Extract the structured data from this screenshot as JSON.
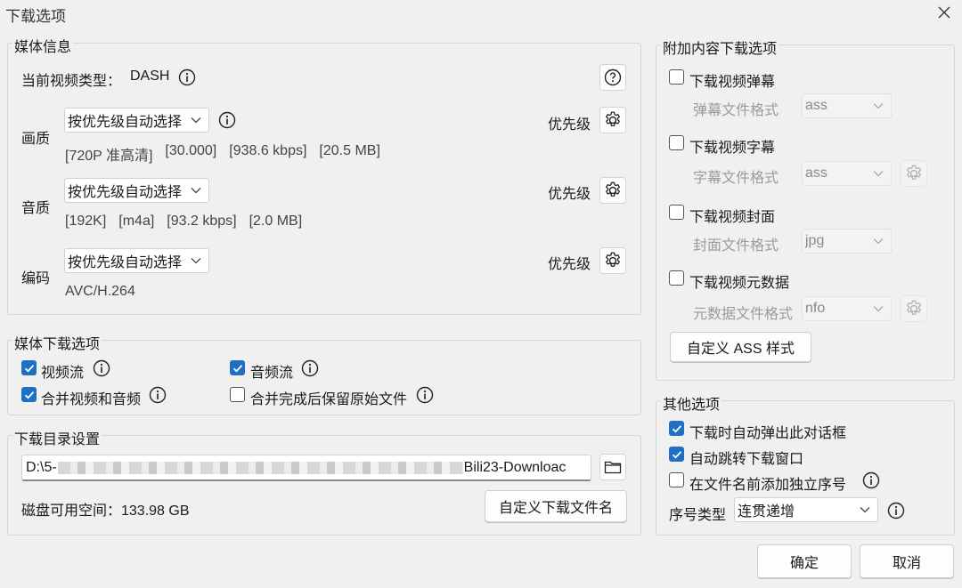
{
  "window": {
    "title": "下载选项",
    "close_icon": "close-icon"
  },
  "media_info": {
    "group_title": "媒体信息",
    "video_type_label": "当前视频类型：",
    "video_type_value": "DASH",
    "quality": {
      "label": "画质",
      "select": "按优先级自动选择",
      "priority_label": "优先级",
      "details": [
        "[720P 准高清]",
        "[30.000]",
        "[938.6 kbps]",
        "[20.5 MB]"
      ]
    },
    "audio": {
      "label": "音质",
      "select": "按优先级自动选择",
      "priority_label": "优先级",
      "details": [
        "[192K]",
        "[m4a]",
        "[93.2 kbps]",
        "[2.0 MB]"
      ]
    },
    "codec": {
      "label": "编码",
      "select": "按优先级自动选择",
      "priority_label": "优先级",
      "details": [
        "AVC/H.264"
      ]
    }
  },
  "media_download": {
    "group_title": "媒体下载选项",
    "video_stream": {
      "label": "视频流",
      "checked": true
    },
    "audio_stream": {
      "label": "音频流",
      "checked": true
    },
    "merge": {
      "label": "合并视频和音频",
      "checked": true
    },
    "keep_original": {
      "label": "合并完成后保留原始文件",
      "checked": false
    }
  },
  "download_dir": {
    "group_title": "下载目录设置",
    "path_prefix": "D:\\5-",
    "path_suffix": "Bili23-Downloac",
    "disk_space": "磁盘可用空间：133.98 GB",
    "custom_filename_button": "自定义下载文件名"
  },
  "extra": {
    "group_title": "附加内容下载选项",
    "danmaku": {
      "label": "下载视频弹幕",
      "checked": false,
      "format_label": "弹幕文件格式",
      "format": "ass"
    },
    "subtitle": {
      "label": "下载视频字幕",
      "checked": false,
      "format_label": "字幕文件格式",
      "format": "ass"
    },
    "cover": {
      "label": "下载视频封面",
      "checked": false,
      "format_label": "封面文件格式",
      "format": "jpg"
    },
    "metadata": {
      "label": "下载视频元数据",
      "checked": false,
      "format_label": "元数据文件格式",
      "format": "nfo"
    },
    "ass_style_button": "自定义 ASS 样式"
  },
  "other": {
    "group_title": "其他选项",
    "auto_popup": {
      "label": "下载时自动弹出此对话框",
      "checked": true
    },
    "auto_jump": {
      "label": "自动跳转下载窗口",
      "checked": true
    },
    "add_index": {
      "label": "在文件名前添加独立序号",
      "checked": false
    },
    "index_type_label": "序号类型",
    "index_type": "连贯递增"
  },
  "footer": {
    "ok": "确定",
    "cancel": "取消"
  },
  "colors": {
    "accent": "#1f6fc4",
    "background": "#f0f0f0"
  }
}
